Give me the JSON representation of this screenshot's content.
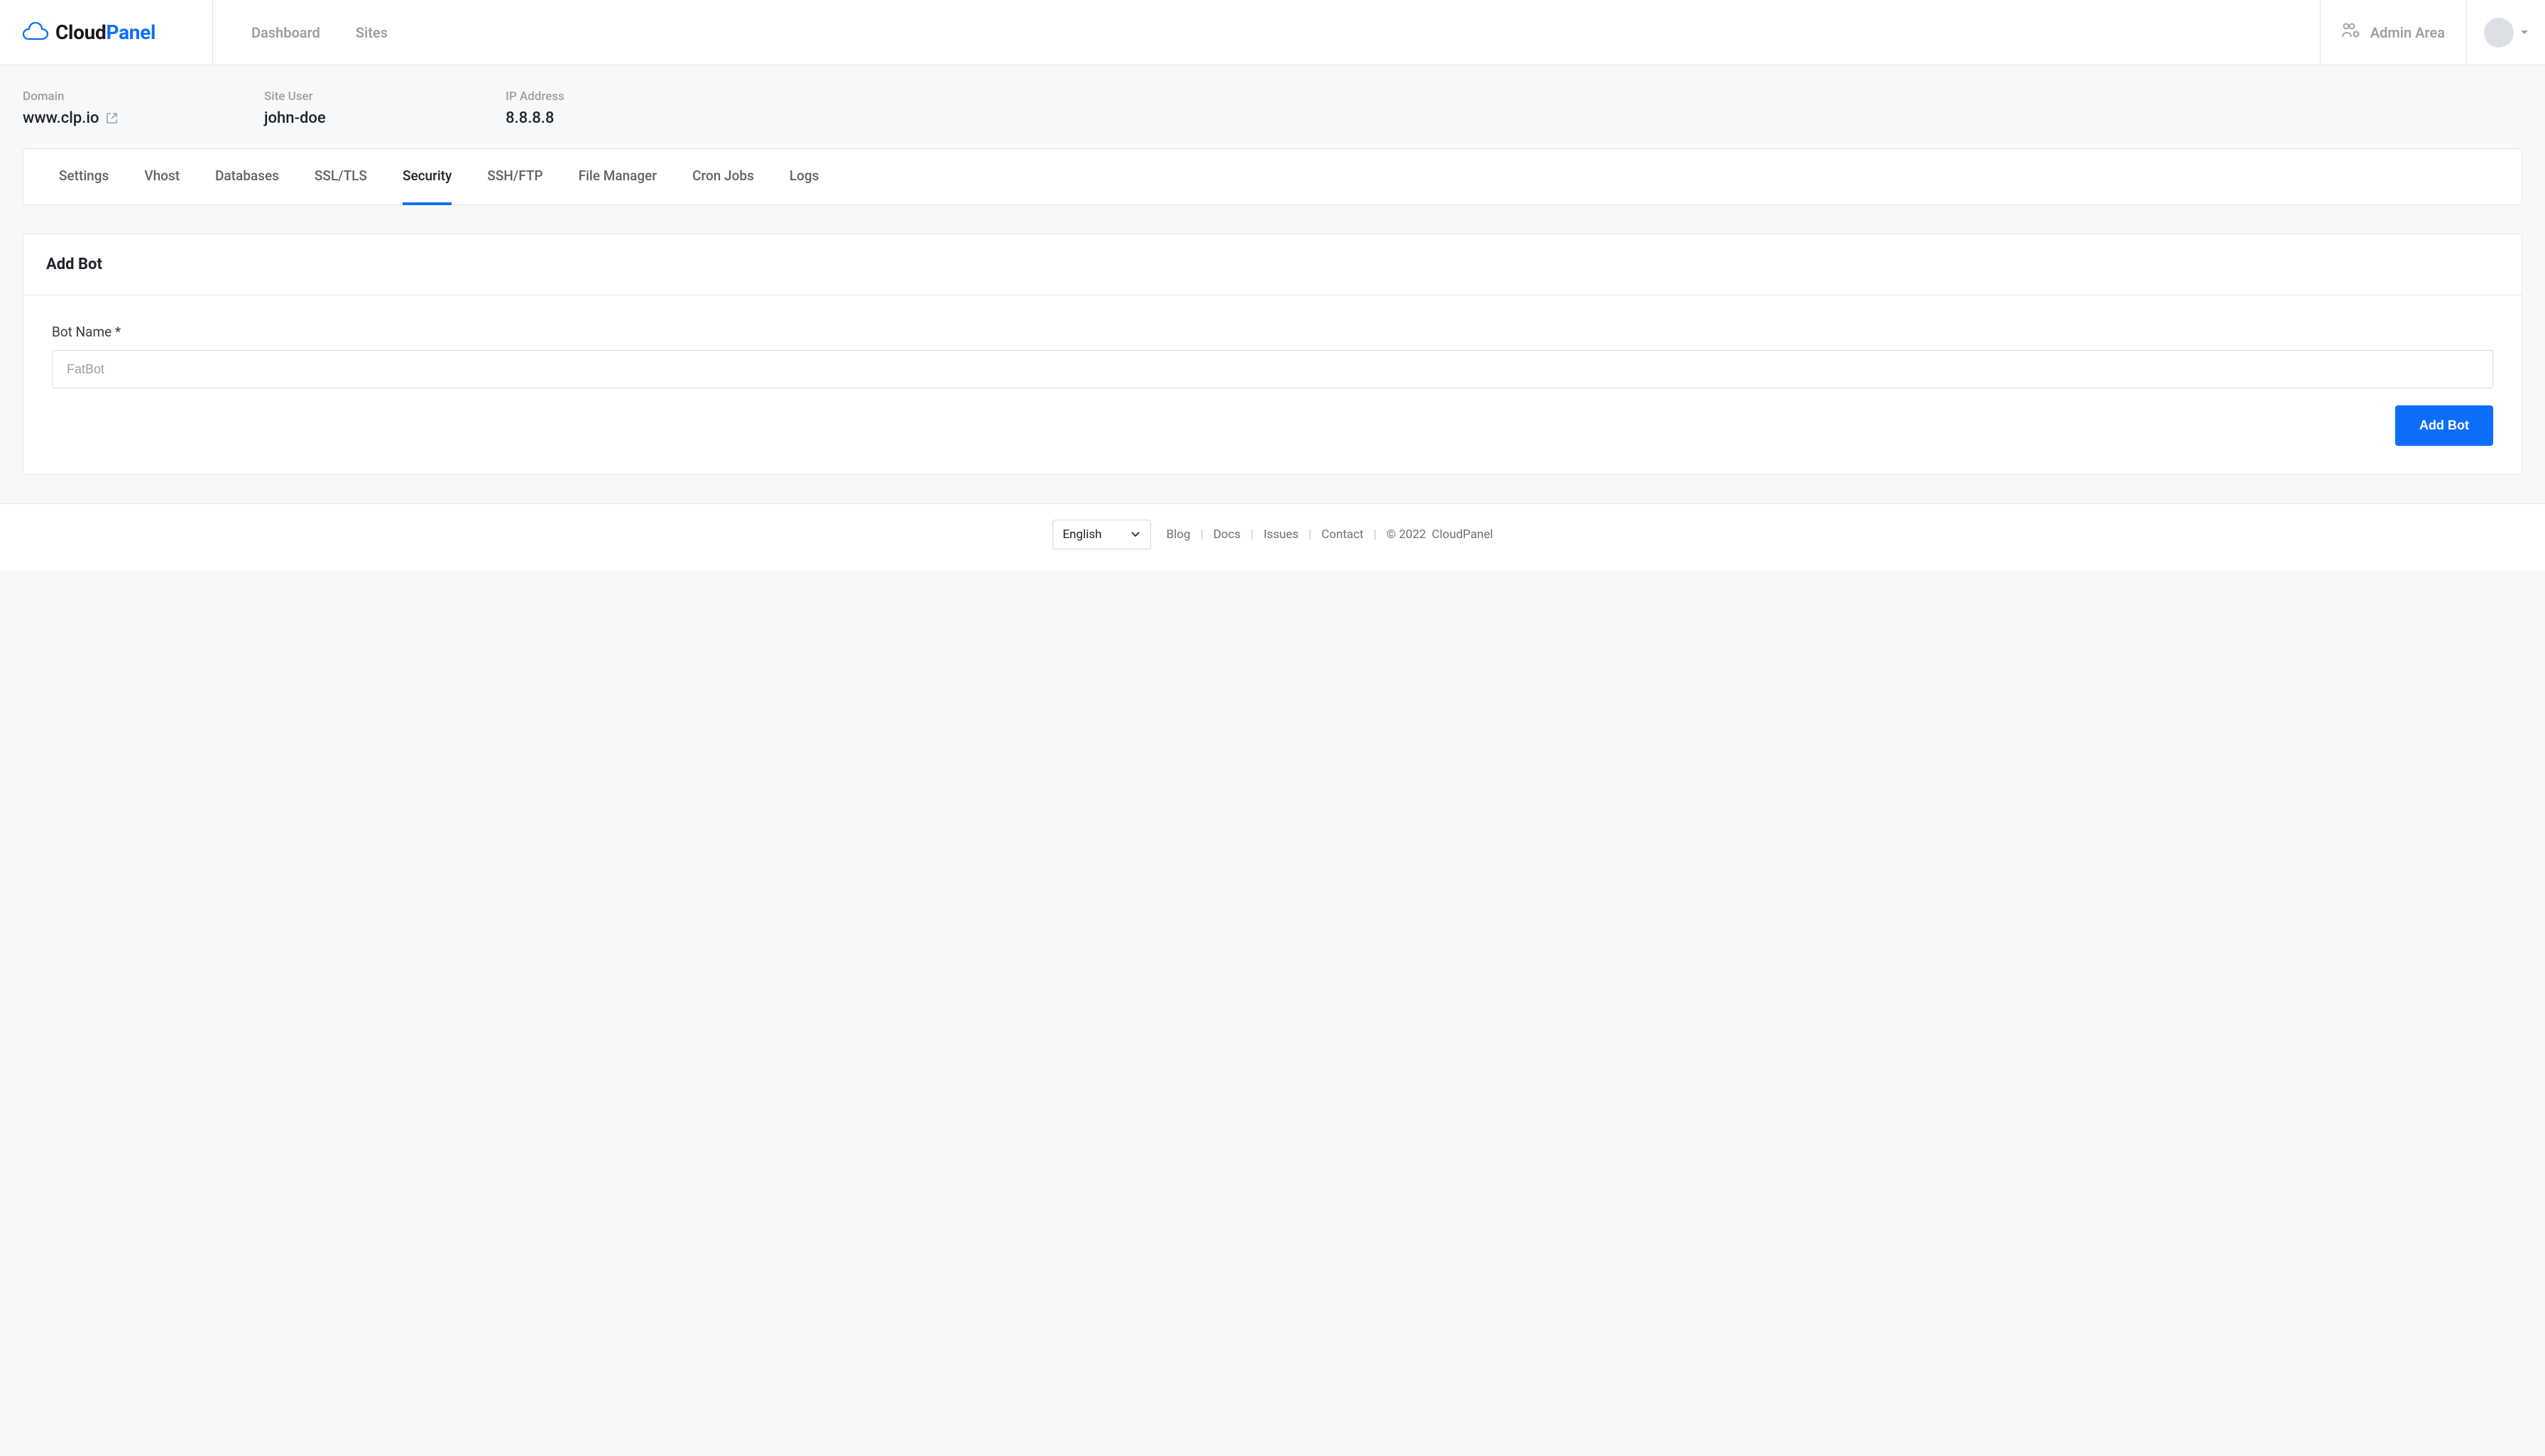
{
  "brand": {
    "name1": "Cloud",
    "name2": "Panel"
  },
  "nav": {
    "dashboard": "Dashboard",
    "sites": "Sites",
    "admin_area": "Admin Area"
  },
  "info": {
    "domain_label": "Domain",
    "domain_value": "www.clp.io",
    "user_label": "Site User",
    "user_value": "john-doe",
    "ip_label": "IP Address",
    "ip_value": "8.8.8.8"
  },
  "tabs": {
    "settings": "Settings",
    "vhost": "Vhost",
    "databases": "Databases",
    "ssl": "SSL/TLS",
    "security": "Security",
    "sshftp": "SSH/FTP",
    "filemanager": "File Manager",
    "cron": "Cron Jobs",
    "logs": "Logs"
  },
  "form": {
    "card_title": "Add Bot",
    "bot_name_label": "Bot Name *",
    "bot_name_placeholder": "FatBot",
    "submit_label": "Add Bot"
  },
  "footer": {
    "language": "English",
    "blog": "Blog",
    "docs": "Docs",
    "issues": "Issues",
    "contact": "Contact",
    "copyright": "© 2022",
    "brand": "CloudPanel"
  }
}
